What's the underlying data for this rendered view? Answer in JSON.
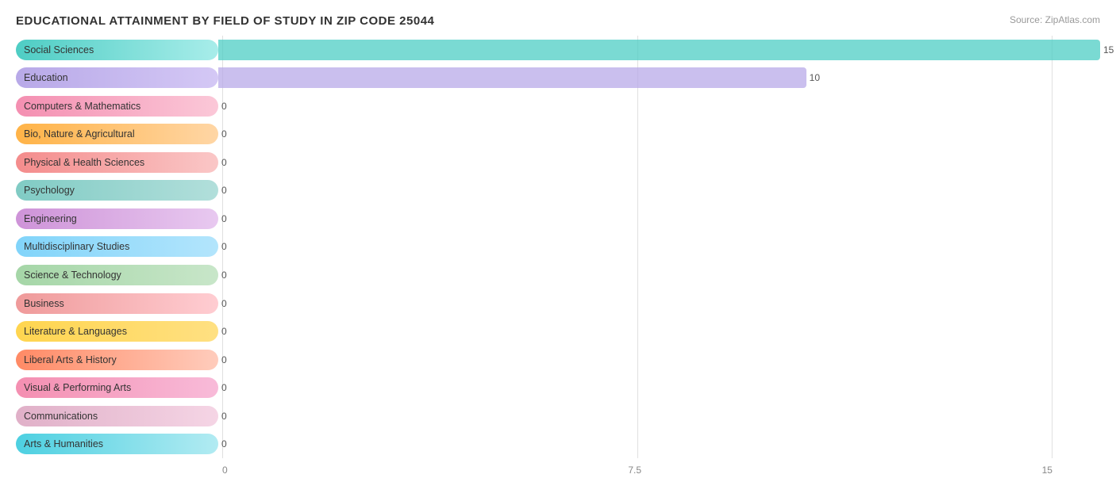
{
  "title": "EDUCATIONAL ATTAINMENT BY FIELD OF STUDY IN ZIP CODE 25044",
  "source": "Source: ZipAtlas.com",
  "chart": {
    "max_value": 15,
    "mid_value": 7.5,
    "x_labels": [
      "0",
      "7.5",
      "15"
    ],
    "bars": [
      {
        "label": "Social Sciences",
        "value": 15,
        "pill_class": "pill-teal",
        "bar_class": "bar-teal",
        "display": "15"
      },
      {
        "label": "Education",
        "value": 10,
        "pill_class": "pill-lavender",
        "bar_class": "bar-lavender",
        "display": "10"
      },
      {
        "label": "Computers & Mathematics",
        "value": 0,
        "pill_class": "pill-pink",
        "bar_class": "bar-pink",
        "display": "0"
      },
      {
        "label": "Bio, Nature & Agricultural",
        "value": 0,
        "pill_class": "pill-peach",
        "bar_class": "bar-peach",
        "display": "0"
      },
      {
        "label": "Physical & Health Sciences",
        "value": 0,
        "pill_class": "pill-salmon",
        "bar_class": "bar-salmon",
        "display": "0"
      },
      {
        "label": "Psychology",
        "value": 0,
        "pill_class": "pill-mint",
        "bar_class": "bar-mint",
        "display": "0"
      },
      {
        "label": "Engineering",
        "value": 0,
        "pill_class": "pill-lilac",
        "bar_class": "bar-lilac",
        "display": "0"
      },
      {
        "label": "Multidisciplinary Studies",
        "value": 0,
        "pill_class": "pill-sky",
        "bar_class": "bar-sky",
        "display": "0"
      },
      {
        "label": "Science & Technology",
        "value": 0,
        "pill_class": "pill-green",
        "bar_class": "bar-green",
        "display": "0"
      },
      {
        "label": "Business",
        "value": 0,
        "pill_class": "pill-rose",
        "bar_class": "bar-rose",
        "display": "0"
      },
      {
        "label": "Literature & Languages",
        "value": 0,
        "pill_class": "pill-gold",
        "bar_class": "bar-gold",
        "display": "0"
      },
      {
        "label": "Liberal Arts & History",
        "value": 0,
        "pill_class": "pill-coral",
        "bar_class": "bar-coral",
        "display": "0"
      },
      {
        "label": "Visual & Performing Arts",
        "value": 0,
        "pill_class": "pill-blush",
        "bar_class": "bar-blush",
        "display": "0"
      },
      {
        "label": "Communications",
        "value": 0,
        "pill_class": "pill-mauve",
        "bar_class": "bar-mauve",
        "display": "0"
      },
      {
        "label": "Arts & Humanities",
        "value": 0,
        "pill_class": "pill-cyan",
        "bar_class": "bar-cyan",
        "display": "0"
      }
    ]
  }
}
